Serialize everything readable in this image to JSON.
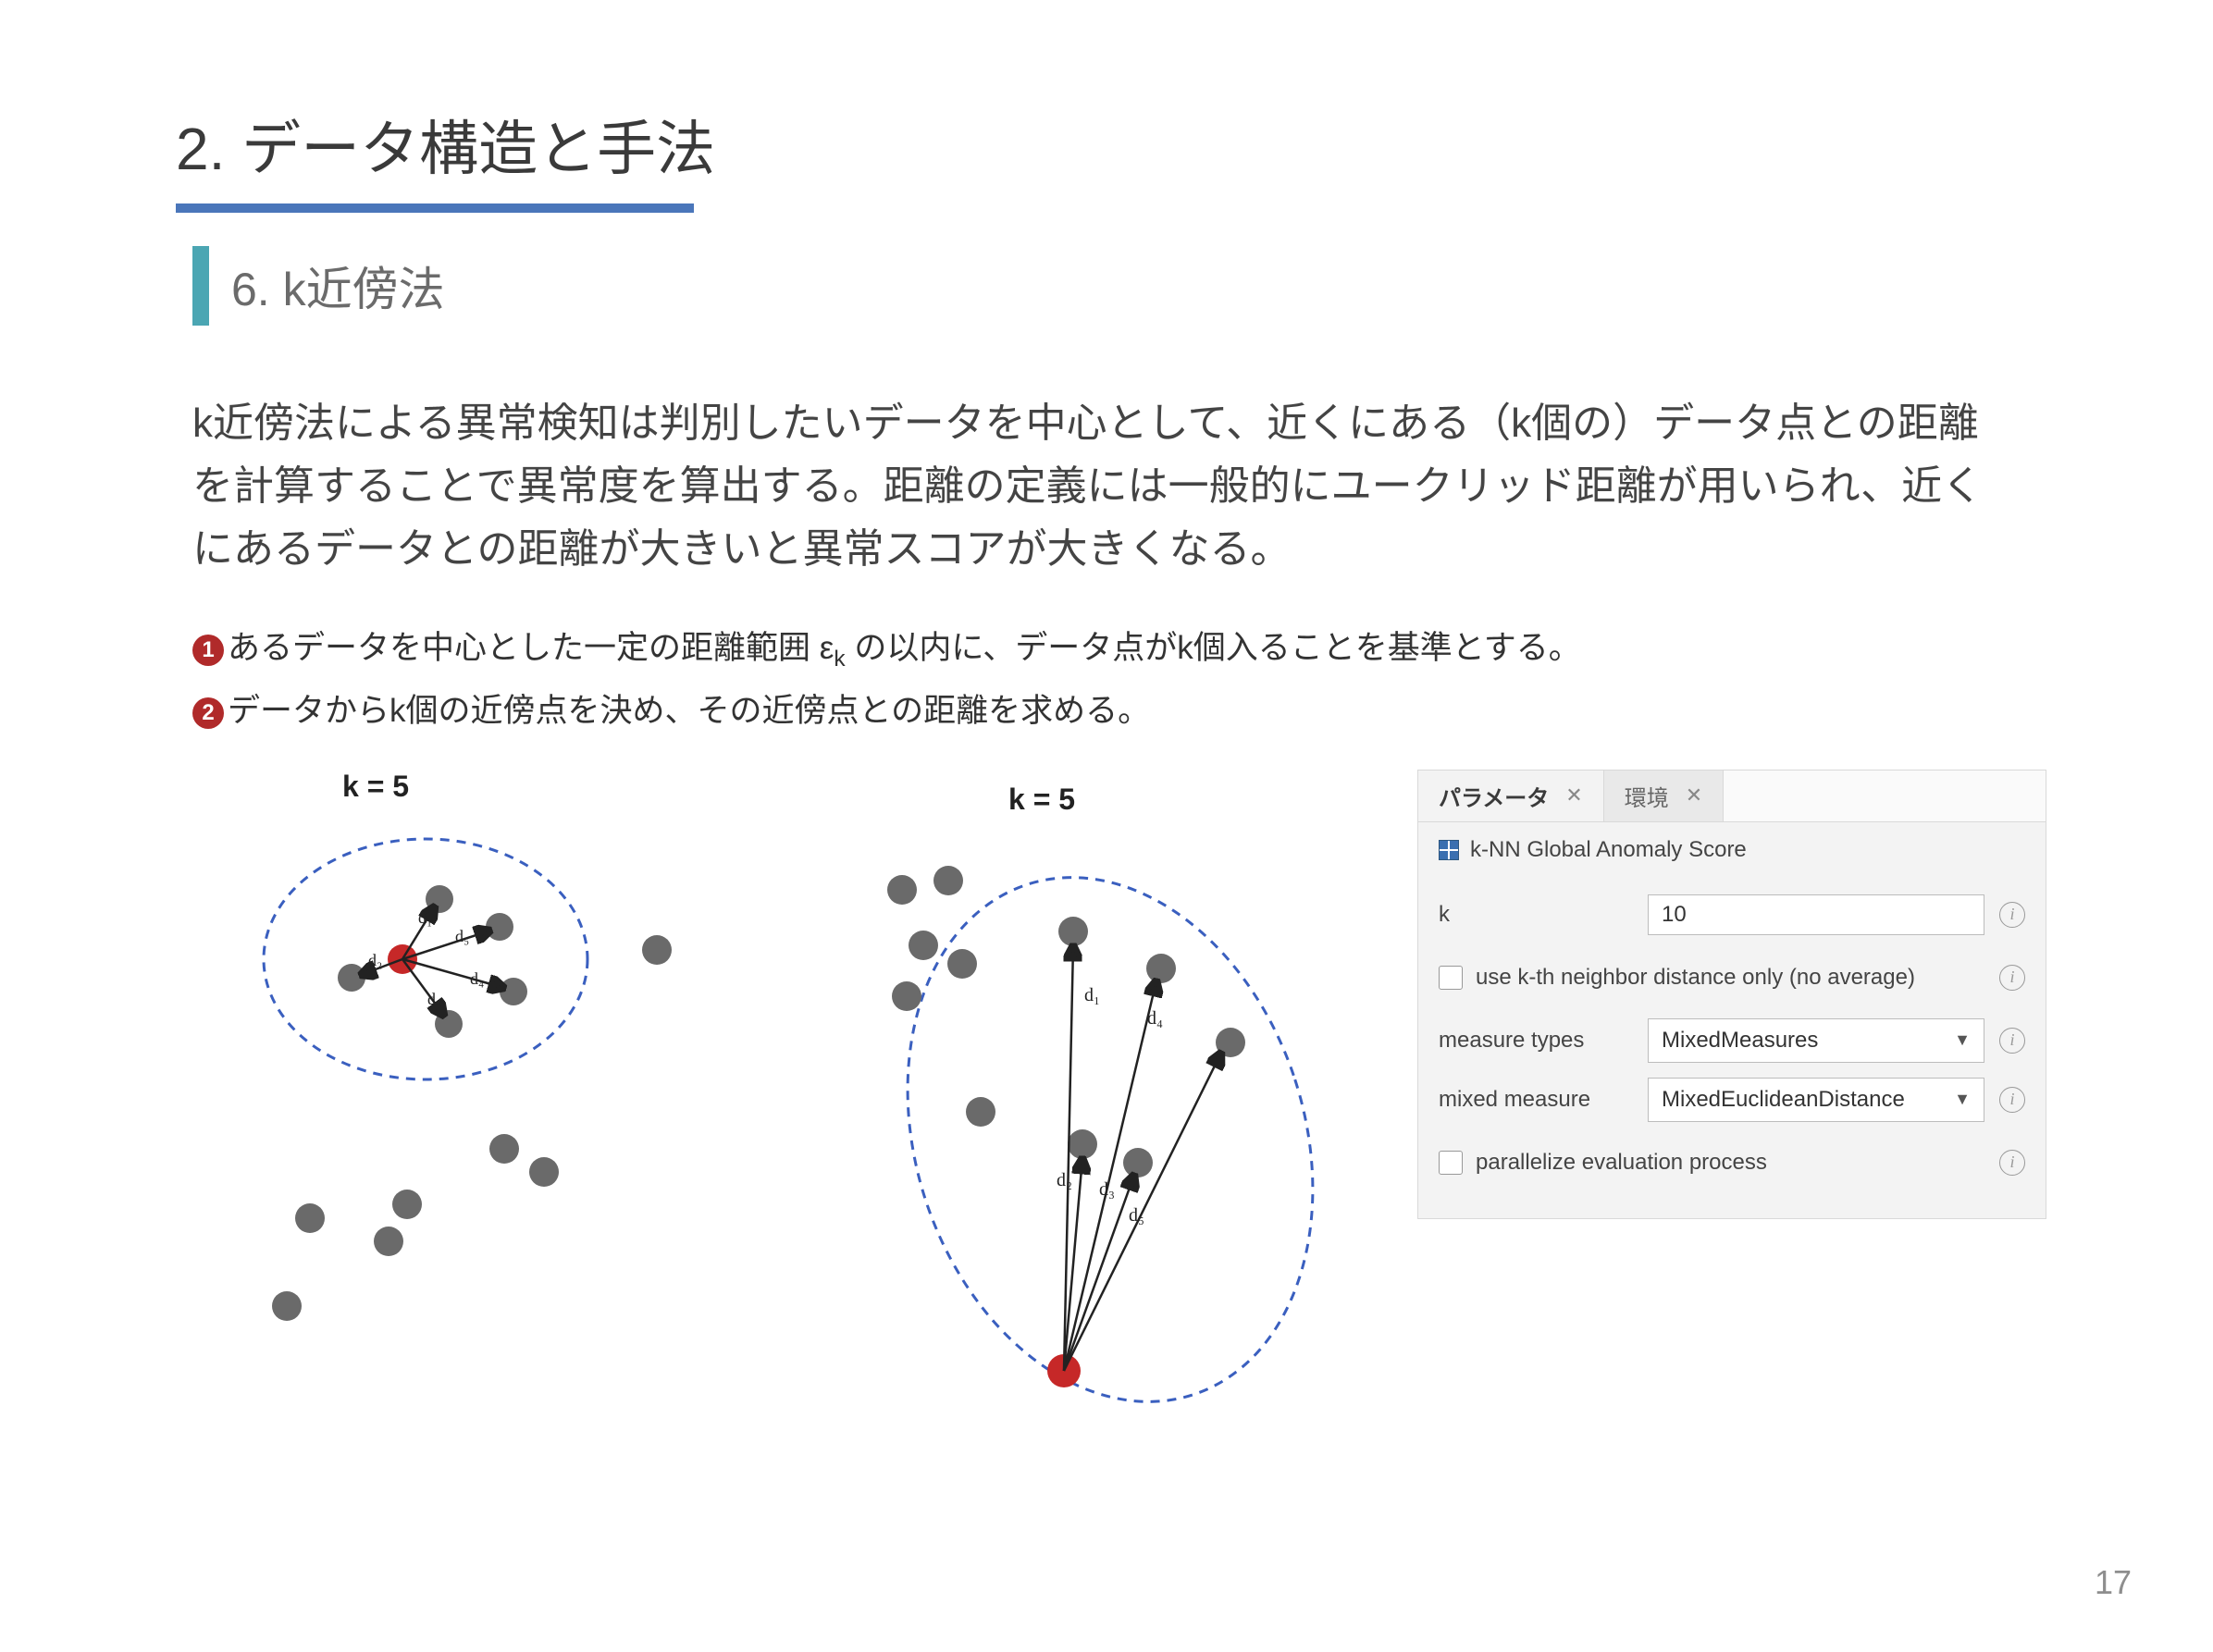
{
  "title": "2. データ構造と手法",
  "subtitle": "6. k近傍法",
  "body": "k近傍法による異常検知は判別したいデータを中心として、近くにある（k個の）データ点との距離を計算することで異常度を算出する。距離の定義には一般的にユークリッド距離が用いられ、近くにあるデータとの距離が大きいと異常スコアが大きくなる。",
  "bullets": {
    "b1_num": "1",
    "b1_pre": "あるデータを中心とした一定の距離範囲 ε",
    "b1_sub": "k",
    "b1_post": " の以内に、データ点がk個入ることを基準とする。",
    "b2_num": "2",
    "b2_text": "データからk個の近傍点を決め、その近傍点との距離を求める。"
  },
  "figure": {
    "left_label": "k = 5",
    "right_label": "k = 5",
    "d_labels": {
      "d1": "d₁",
      "d2": "d₂",
      "d3": "d₃",
      "d4": "d₄",
      "d5": "d₅"
    }
  },
  "panel": {
    "tabs": {
      "active": "パラメータ",
      "inactive": "環境"
    },
    "header": "k-NN Global Anomaly Score",
    "rows": {
      "k_label": "k",
      "k_value": "10",
      "chk_kth": "use k-th neighbor distance only (no average)",
      "measure_types_label": "measure types",
      "measure_types_value": "MixedMeasures",
      "mixed_measure_label": "mixed measure",
      "mixed_measure_value": "MixedEuclideanDistance",
      "chk_parallel": "parallelize evaluation process"
    }
  },
  "page_number": "17"
}
